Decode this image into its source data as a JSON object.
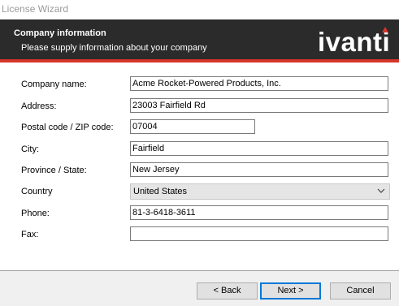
{
  "window": {
    "title": "License Wizard"
  },
  "header": {
    "title": "Company information",
    "subtitle": "Please supply information about your company",
    "logo_text": "ivanti"
  },
  "form": {
    "company_name": {
      "label": "Company name:",
      "value": "Acme Rocket-Powered Products, Inc."
    },
    "address": {
      "label": "Address:",
      "value": "23003 Fairfield Rd"
    },
    "postal_code": {
      "label": "Postal code / ZIP code:",
      "value": "07004"
    },
    "city": {
      "label": "City:",
      "value": "Fairfield"
    },
    "province": {
      "label": "Province / State:",
      "value": "New Jersey"
    },
    "country": {
      "label": "Country",
      "value": "United States"
    },
    "phone": {
      "label": "Phone:",
      "value": "81-3-6418-3611"
    },
    "fax": {
      "label": "Fax:",
      "value": ""
    }
  },
  "buttons": {
    "back": "< Back",
    "next": "Next >",
    "cancel": "Cancel"
  },
  "colors": {
    "header_bg": "#2b2b2b",
    "accent_red": "#d6352c",
    "default_button_border": "#0078d7"
  },
  "icons": {
    "country_dropdown": "chevron-down-icon"
  }
}
